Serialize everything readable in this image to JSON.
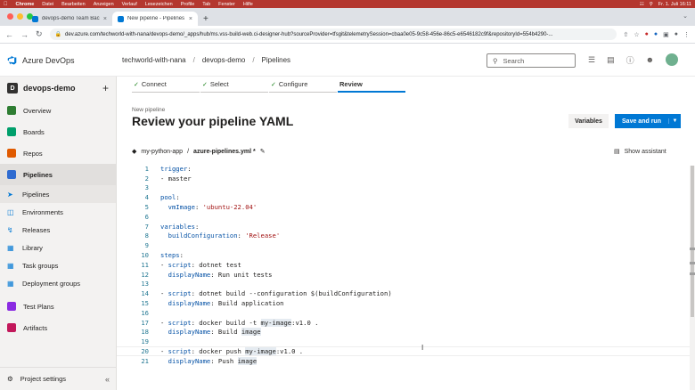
{
  "mac_menu": {
    "app": "Chrome",
    "items": [
      "Datei",
      "Bearbeiten",
      "Anzeigen",
      "Verlauf",
      "Lesezeichen",
      "Profile",
      "Tab",
      "Fenster",
      "Hilfe"
    ],
    "clock": "Fr. 1. Juli 16:11"
  },
  "browser": {
    "tabs": [
      {
        "title": "devops-demo Team Backlog B..."
      },
      {
        "title": "New pipeline - Pipelines"
      }
    ],
    "url": "dev.azure.com/techworld-with-nana/devops-demo/_apps/hub/ms.vss-build-web.ci-designer-hub?sourceProvider=tfsgit&telemetrySession=cbaa0e05-9c58-456e-86c5-e6546182c9f&repositoryId=554b4290-..."
  },
  "header": {
    "brand": "Azure DevOps",
    "breadcrumbs": [
      "techworld-with-nana",
      "devops-demo",
      "Pipelines"
    ],
    "search_placeholder": "Search"
  },
  "sidebar": {
    "project": "devops-demo",
    "project_initial": "D",
    "items": [
      {
        "label": "Overview",
        "color": "#2e7d32"
      },
      {
        "label": "Boards",
        "color": "#009f6b"
      },
      {
        "label": "Repos",
        "color": "#e05a00"
      },
      {
        "label": "Pipelines",
        "color": "#2f6bd0"
      }
    ],
    "sub_items": [
      "Pipelines",
      "Environments",
      "Releases",
      "Library",
      "Task groups",
      "Deployment groups"
    ],
    "bottom_items": [
      {
        "label": "Test Plans",
        "color": "#8a2be2"
      },
      {
        "label": "Artifacts",
        "color": "#c2185b"
      }
    ],
    "footer": "Project settings"
  },
  "wizard": {
    "steps": [
      {
        "label": "Connect",
        "done": true
      },
      {
        "label": "Select",
        "done": true
      },
      {
        "label": "Configure",
        "done": true
      },
      {
        "label": "Review",
        "done": false
      }
    ]
  },
  "page": {
    "subtitle": "New pipeline",
    "title": "Review your pipeline YAML",
    "variables_label": "Variables",
    "save_label": "Save and run"
  },
  "file": {
    "repo": "my-python-app",
    "sep": "/",
    "name": "azure-pipelines.yml *",
    "assistant": "Show assistant"
  },
  "code_lines": [
    "trigger:",
    "- master",
    "",
    "pool:",
    "  vmImage: 'ubuntu-22.04'",
    "",
    "variables:",
    "  buildConfiguration: 'Release'",
    "",
    "steps:",
    "- script: dotnet test",
    "  displayName: Run unit tests",
    "",
    "- script: dotnet build --configuration $(buildConfiguration)",
    "  displayName: Build application",
    "",
    "- script: docker build -t my-image:v1.0 .",
    "  displayName: Build image",
    "",
    "- script: docker push my-image:v1.0 .",
    "  displayName: Push image"
  ]
}
